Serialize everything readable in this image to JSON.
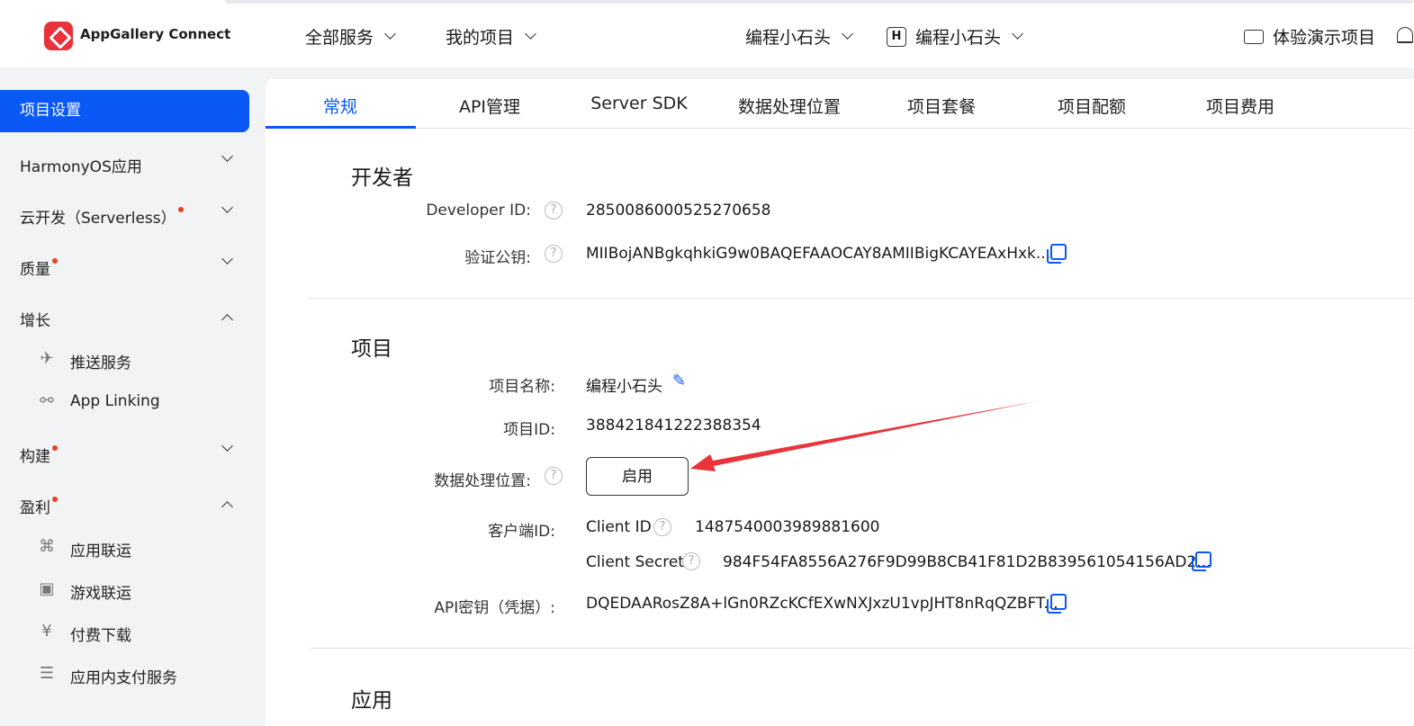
{
  "header": {
    "brand": "AppGallery Connect",
    "nav_all_services": "全部服务",
    "nav_my_projects": "我的项目",
    "team_name": "编程小石头",
    "account_badge": "H",
    "account_name": "编程小石头",
    "demo_project": "体验演示项目"
  },
  "sidebar": {
    "active": "项目设置",
    "items": [
      {
        "label": "HarmonyOS应用"
      },
      {
        "label": "云开发（Serverless）"
      },
      {
        "label": "质量"
      },
      {
        "label": "增长"
      },
      {
        "label": "推送服务"
      },
      {
        "label": "App Linking"
      },
      {
        "label": "构建"
      },
      {
        "label": "盈利"
      },
      {
        "label": "应用联运"
      },
      {
        "label": "游戏联运"
      },
      {
        "label": "付费下载"
      },
      {
        "label": "应用内支付服务"
      }
    ]
  },
  "tabs": [
    "常规",
    "API管理",
    "Server SDK",
    "数据处理位置",
    "项目套餐",
    "项目配额",
    "项目费用"
  ],
  "developer": {
    "title": "开发者",
    "id_label": "Developer ID:",
    "id_value": "2850086000525270658",
    "key_label": "验证公钥:",
    "key_value": "MIIBojANBgkqhkiG9w0BAQEFAAOCAY8AMIIBigKCAYEAxHxk..."
  },
  "project": {
    "title": "项目",
    "name_label": "项目名称:",
    "name_value": "编程小石头",
    "id_label": "项目ID:",
    "id_value": "388421841222388354",
    "location_label": "数据处理位置:",
    "enable_button": "启用",
    "client_label": "客户端ID:",
    "client_id_label": "Client ID",
    "client_id_value": "1487540003989881600",
    "client_secret_label": "Client Secret",
    "client_secret_value": "984F54FA8556A276F9D99B8CB41F81D2B839561054156AD2...",
    "api_key_label": "API密钥（凭据）:",
    "api_key_value": "DQEDAARosZ8A+lGn0RZcKCfEXwNXJxzU1vpJHT8nRqQZBFT..."
  },
  "apps": {
    "title": "应用"
  },
  "colors": {
    "accent": "#0a59f7",
    "brand": "#e9323a",
    "arrow": "#e8343a",
    "badge_dot": "#e84026"
  }
}
